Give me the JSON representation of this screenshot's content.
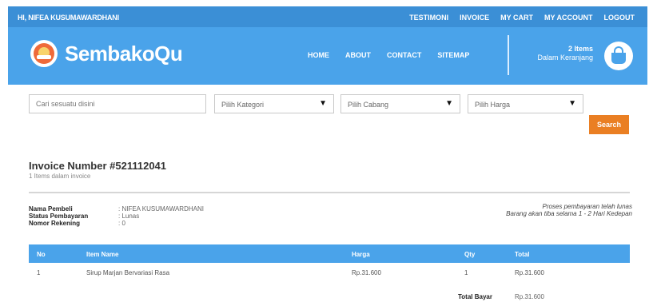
{
  "topbar": {
    "greeting": "HI, NIFEA KUSUMAWARDHANI",
    "links": [
      "TESTIMONI",
      "INVOICE",
      "MY CART",
      "MY ACCOUNT",
      "LOGOUT"
    ]
  },
  "header": {
    "brand": "SembakoQu",
    "nav": [
      "HOME",
      "ABOUT",
      "CONTACT",
      "SITEMAP"
    ],
    "cart_count": "2 Items",
    "cart_label": "Dalam Keranjang"
  },
  "search": {
    "placeholder": "Cari sesuatu disini",
    "category": "Pilih Kategori",
    "branch": "Pilih Cabang",
    "price": "Pilih Harga",
    "button": "Search"
  },
  "invoice": {
    "title": "Invoice Number #521112041",
    "subtitle": "1 Items dalam invoice",
    "info": [
      {
        "label": "Nama Pembeli",
        "value": ": NIFEA KUSUMAWARDHANI"
      },
      {
        "label": "Status Pembayaran",
        "value": ": Lunas"
      },
      {
        "label": "Nomor Rekening",
        "value": ": 0"
      }
    ],
    "note_line1": "Proses pembayaran telah lunas",
    "note_line2": "Barang akan tiba selama 1 - 2 Hari Kedepan",
    "columns": [
      "No",
      "Item Name",
      "Harga",
      "Qty",
      "Total"
    ],
    "rows": [
      {
        "no": "1",
        "name": "Sirup Marjan Bervariasi Rasa",
        "price": "Rp.31.600",
        "qty": "1",
        "total": "Rp.31.600"
      }
    ],
    "total_label": "Total Bayar",
    "total_value": "Rp.31.600"
  },
  "colors": {
    "topbar": "#3b8fd6",
    "header": "#4aa3ea",
    "accent_button": "#ea7f23"
  }
}
